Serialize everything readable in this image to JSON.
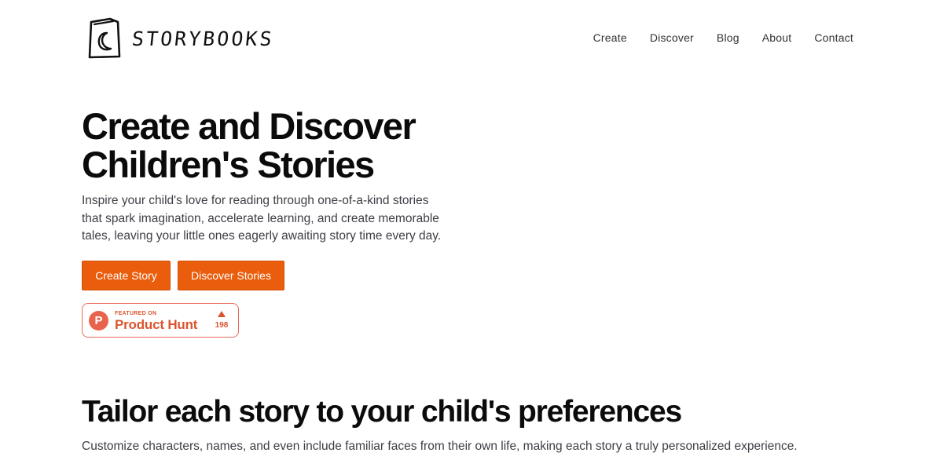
{
  "brand": {
    "name": "STORYBOOKS",
    "logo_icon": "book-moon-icon"
  },
  "nav": {
    "items": [
      {
        "label": "Create"
      },
      {
        "label": "Discover"
      },
      {
        "label": "Blog"
      },
      {
        "label": "About"
      },
      {
        "label": "Contact"
      }
    ]
  },
  "hero": {
    "title_line1": "Create and Discover",
    "title_line2": "Children's Stories",
    "description": "Inspire your child's love for reading through one-of-a-kind stories that spark imagination, accelerate learning, and create memorable tales, leaving your little ones eagerly awaiting story time every day.",
    "primary_button": "Create Story",
    "secondary_button": "Discover Stories",
    "accent_color": "#ea5d0c"
  },
  "product_hunt": {
    "featured_label": "FEATURED ON",
    "name": "Product Hunt",
    "logo_letter": "P",
    "upvotes": "198",
    "color": "#da552f"
  },
  "section": {
    "title": "Tailor each story to your child's preferences",
    "description": "Customize characters, names, and even include familiar faces from their own life, making each story a truly personalized experience."
  }
}
